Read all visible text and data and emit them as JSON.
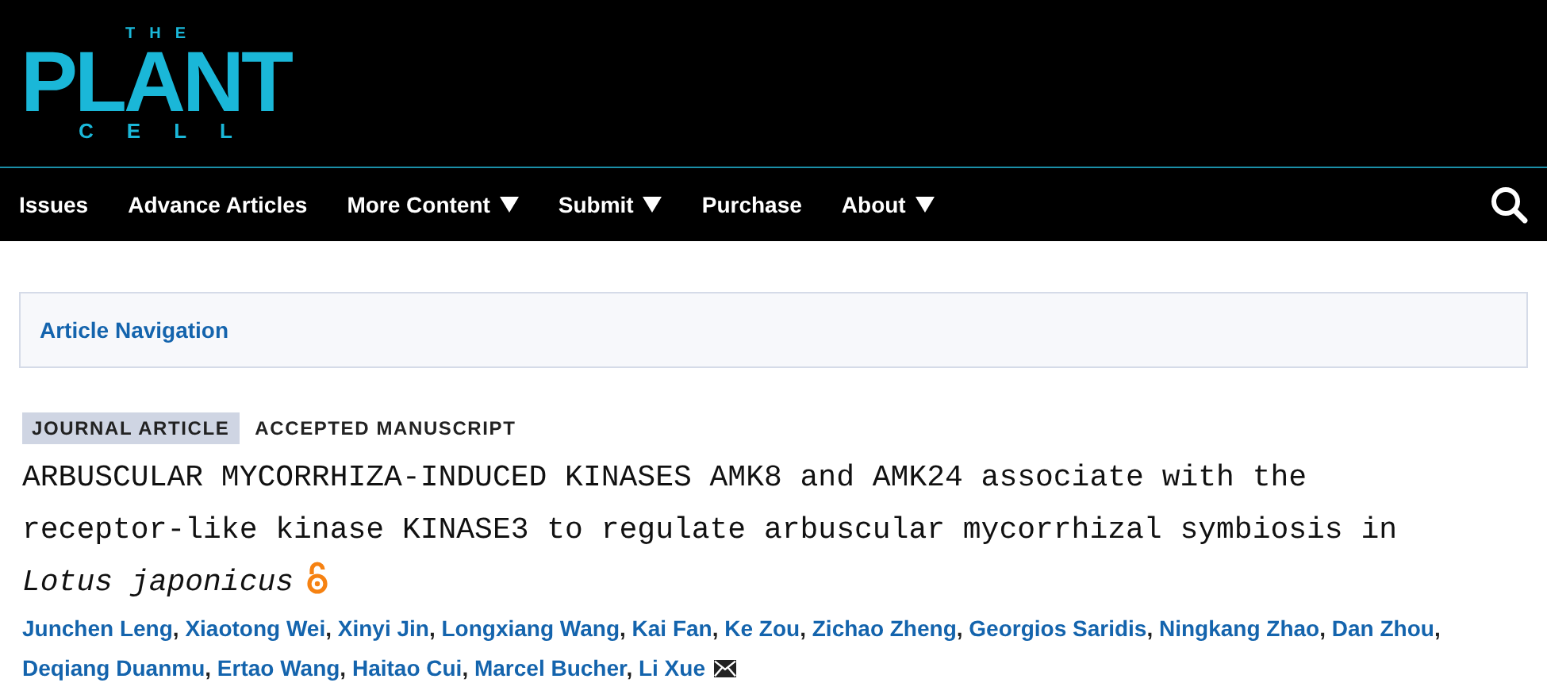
{
  "logo": {
    "top": "THE",
    "main": "PLANT",
    "bottom": "CELL"
  },
  "nav": [
    {
      "label": "Issues",
      "dropdown": false
    },
    {
      "label": "Advance Articles",
      "dropdown": false
    },
    {
      "label": "More Content",
      "dropdown": true
    },
    {
      "label": "Submit",
      "dropdown": true
    },
    {
      "label": "Purchase",
      "dropdown": false
    },
    {
      "label": "About",
      "dropdown": true
    }
  ],
  "article_navigation": {
    "label": "Article Navigation"
  },
  "article": {
    "type": "JOURNAL ARTICLE",
    "status": "ACCEPTED MANUSCRIPT",
    "title": "ARBUSCULAR MYCORRHIZA-INDUCED KINASES AMK8 and AMK24 associate with the receptor-like kinase KINASE3 to regulate arbuscular mycorrhizal symbiosis in *Lotus japonicus*",
    "open_access": true,
    "authors": [
      {
        "name": "Junchen Leng",
        "separator": ",",
        "corresponding": false
      },
      {
        "name": "Xiaotong Wei",
        "separator": ",",
        "corresponding": false
      },
      {
        "name": "Xinyi Jin",
        "separator": ",",
        "corresponding": false
      },
      {
        "name": "Longxiang Wang",
        "separator": ",",
        "corresponding": false
      },
      {
        "name": "Kai Fan",
        "separator": ",",
        "corresponding": false
      },
      {
        "name": "Ke Zou",
        "separator": ",",
        "corresponding": false
      },
      {
        "name": "Zichao Zheng",
        "separator": ",",
        "corresponding": false
      },
      {
        "name": "Georgios Saridis",
        "separator": ",",
        "corresponding": false
      },
      {
        "name": "Ningkang Zhao",
        "separator": ",",
        "corresponding": false
      },
      {
        "name": "Dan Zhou",
        "separator": ",",
        "corresponding": false
      },
      {
        "name": "Deqiang Duanmu",
        "separator": ",",
        "corresponding": false
      },
      {
        "name": "Ertao Wang",
        "separator": ",",
        "corresponding": false
      },
      {
        "name": "Haitao Cui",
        "separator": ",",
        "corresponding": false
      },
      {
        "name": "Marcel Bucher",
        "separator": ",",
        "corresponding": false
      },
      {
        "name": "Li Xue",
        "corresponding": true
      }
    ]
  }
}
